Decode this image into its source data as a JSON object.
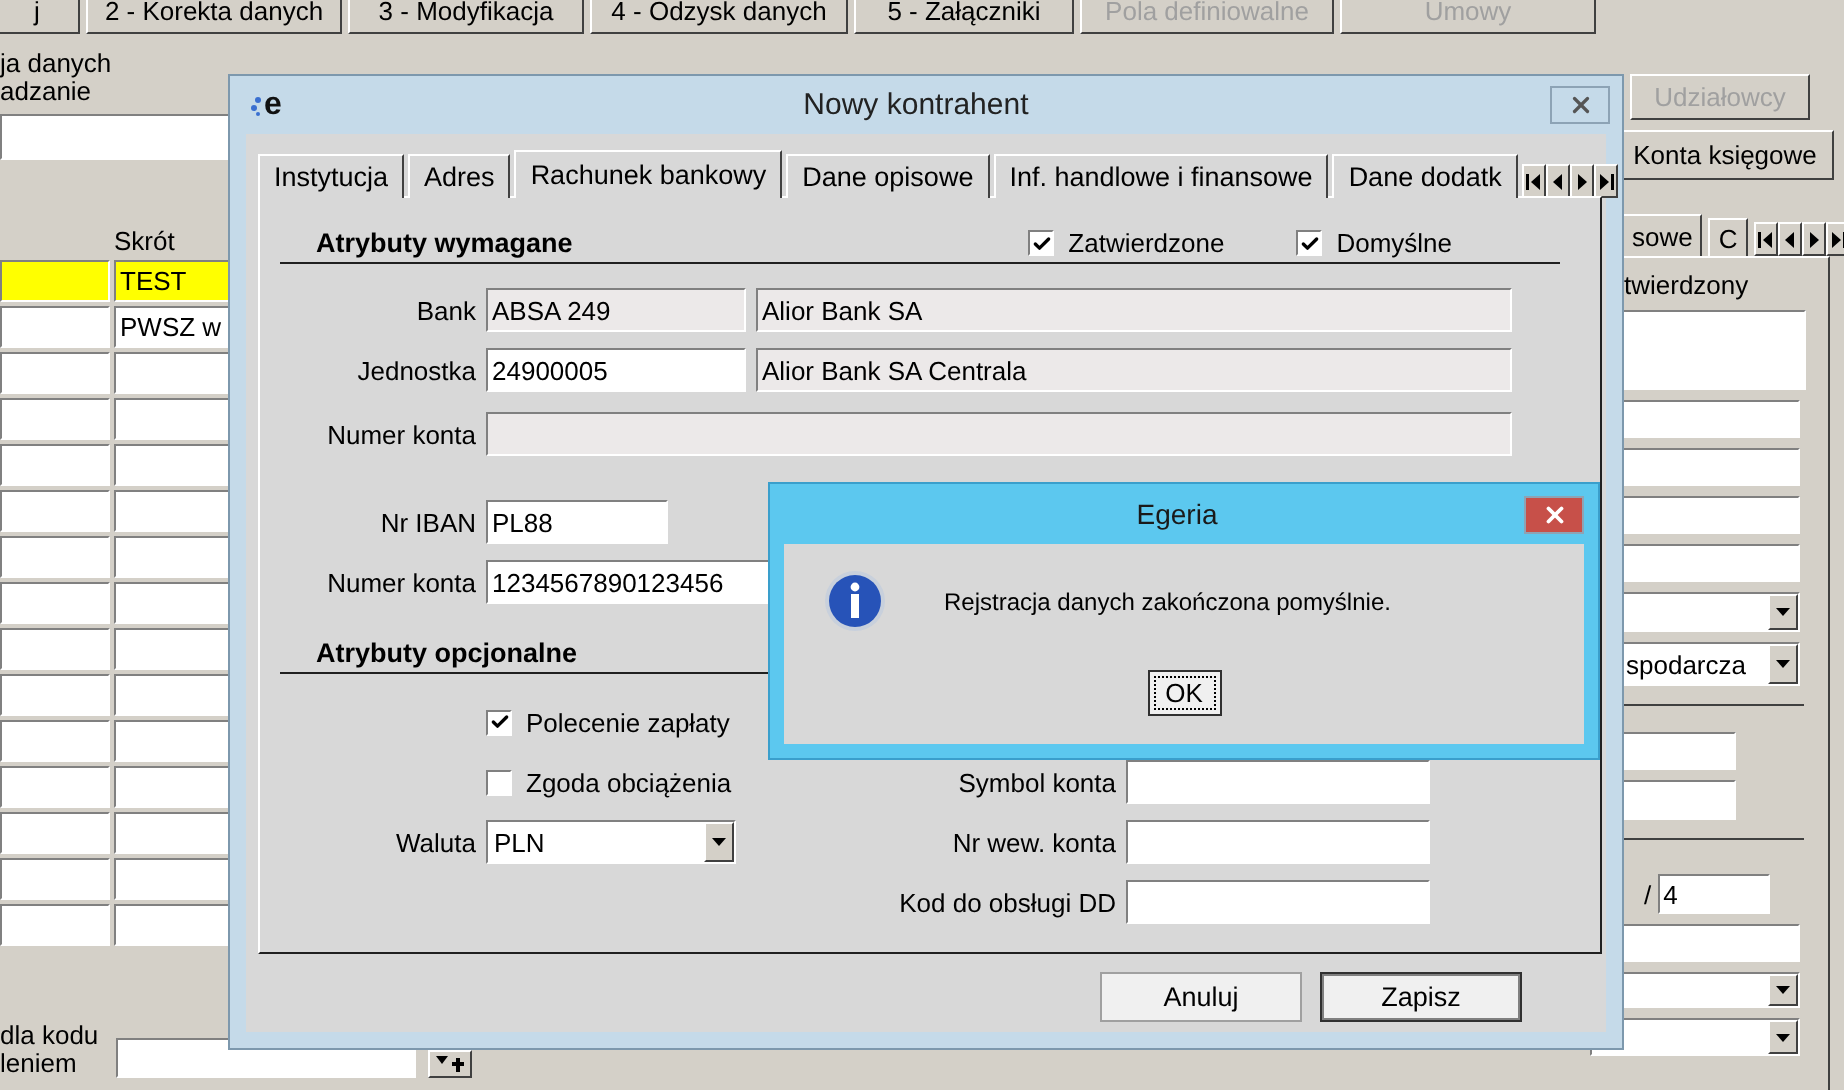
{
  "toolbar": [
    {
      "label": "j",
      "disabled": false
    },
    {
      "label": "2 - Korekta danych",
      "disabled": false
    },
    {
      "label": "3 - Modyfikacja",
      "disabled": false
    },
    {
      "label": "4 - Odzysk danych",
      "disabled": false
    },
    {
      "label": "5 - Załączniki",
      "disabled": false
    },
    {
      "label": "Pola definiowalne",
      "disabled": true
    },
    {
      "label": "Umowy",
      "disabled": true
    }
  ],
  "left_panel": {
    "group_labels": [
      "ja danych",
      "adzanie"
    ],
    "grid": {
      "column_2": "Skrót",
      "rows": [
        {
          "cell_2": "TEST",
          "selected": true
        },
        {
          "cell_2": "PWSZ w",
          "selected": false
        }
      ]
    },
    "bottom_labels": [
      "dla kodu",
      "leniem"
    ]
  },
  "right_panel": {
    "buttons": [
      {
        "label": "Udziałowcy",
        "disabled": true
      },
      {
        "label": "Konta księgowe",
        "disabled": false
      }
    ],
    "tabs": [
      {
        "label": "sowe",
        "selected": true
      },
      {
        "label": "C",
        "selected": false
      }
    ],
    "label": "twierdzony",
    "dropdown_value": "spodarcza",
    "separator": "/",
    "number_value": "4"
  },
  "dialog": {
    "logo_letter": "e",
    "title": "Nowy kontrahent",
    "tabs": [
      {
        "label": "Instytucja",
        "selected": false
      },
      {
        "label": "Adres",
        "selected": false
      },
      {
        "label": "Rachunek bankowy",
        "selected": true
      },
      {
        "label": "Dane opisowe",
        "selected": false
      },
      {
        "label": "Inf. handlowe i finansowe",
        "selected": false
      },
      {
        "label": "Dane dodatk",
        "selected": false
      }
    ],
    "required": {
      "title": "Atrybuty wymagane",
      "checkboxes": [
        {
          "label": "Zatwierdzone",
          "checked": true
        },
        {
          "label": "Domyślne",
          "checked": true
        }
      ],
      "rows": [
        {
          "label": "Bank",
          "fields": [
            {
              "value": "ABSA 249",
              "readonly": true
            },
            {
              "value": "Alior Bank SA",
              "readonly": true
            }
          ]
        },
        {
          "label": "Jednostka",
          "fields": [
            {
              "value": "24900005",
              "readonly": false
            },
            {
              "value": "Alior Bank SA Centrala",
              "readonly": true
            }
          ]
        },
        {
          "label": "Numer konta",
          "fields": [
            {
              "readonly": true
            }
          ]
        },
        {
          "label": "Nr IBAN",
          "fields": [
            {
              "value": "PL88",
              "readonly": false
            }
          ]
        },
        {
          "label": "Numer konta",
          "fields": [
            {
              "value": "1234567890123456",
              "readonly": false
            }
          ]
        }
      ]
    },
    "optional": {
      "title": "Atrybuty opcjonalne",
      "left": [
        {
          "kind": "checkbox",
          "label": "Polecenie zapłaty",
          "checked": true
        },
        {
          "kind": "checkbox",
          "label": "Zgoda obciążenia",
          "checked": false
        },
        {
          "kind": "dropdown",
          "label": "Waluta",
          "value": "PLN"
        }
      ],
      "right": [
        {
          "label": "Symbol konta"
        },
        {
          "label": "Nr wew. konta"
        },
        {
          "label": "Kod do obsługi DD"
        }
      ]
    },
    "buttons": [
      {
        "label": "Anuluj",
        "default": false
      },
      {
        "label": "Zapisz",
        "default": true
      }
    ]
  },
  "message_box": {
    "title": "Egeria",
    "message": "Rejstracja danych zakończona pomyślnie.",
    "button": "OK"
  }
}
